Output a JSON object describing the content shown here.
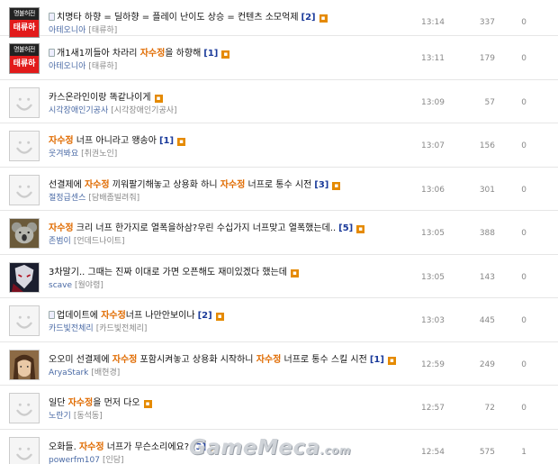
{
  "posts": [
    {
      "avatar": "badge",
      "badge_top": "명불허전",
      "badge_bottom": "태류하",
      "doc": true,
      "segments": [
        {
          "t": "치명타 하향 = 딜하향 = 플레이 난이도 상승 = 컨텐츠 소모억제"
        }
      ],
      "comments": "[2]",
      "new_icon": "new-icon",
      "author": "아테오니아",
      "group": "[태류하]",
      "time": "13:14",
      "views": "337",
      "likes": "0"
    },
    {
      "avatar": "badge",
      "badge_top": "명불허전",
      "badge_bottom": "태류하",
      "doc": true,
      "segments": [
        {
          "t": "개1새1끼들아 차라리 "
        },
        {
          "t": "자수정",
          "hl": true
        },
        {
          "t": "을 하향해"
        }
      ],
      "comments": "[1]",
      "new_icon": "new-icon",
      "author": "아테오니아",
      "group": "[태류하]",
      "time": "13:11",
      "views": "179",
      "likes": "0"
    },
    {
      "avatar": "default",
      "doc": false,
      "segments": [
        {
          "t": "카스온라인이랑 똑같나이게"
        }
      ],
      "comments": "",
      "new_icon": "new-icon",
      "author": "시각장애인기공사",
      "group": "[시각장애인기공사]",
      "time": "13:09",
      "views": "57",
      "likes": "0"
    },
    {
      "avatar": "default",
      "doc": false,
      "segments": [
        {
          "t": "자수정",
          "hl": true
        },
        {
          "t": " 너프 아니라고 왱송아"
        }
      ],
      "comments": "[1]",
      "new_icon": "new-icon",
      "author": "웃겨봐요",
      "group": "[취권노인]",
      "time": "13:07",
      "views": "156",
      "likes": "0"
    },
    {
      "avatar": "default",
      "doc": false,
      "segments": [
        {
          "t": "선결제에 "
        },
        {
          "t": "자수정",
          "hl": true
        },
        {
          "t": " 끼워팔기해놓고 상용화 하니 "
        },
        {
          "t": "자수정",
          "hl": true
        },
        {
          "t": " 너프로 통수 시전"
        }
      ],
      "comments": "[3]",
      "new_icon": "new-icon",
      "author": "절정급센스",
      "group": "[담배좀빌려줘]",
      "time": "13:06",
      "views": "301",
      "likes": "0"
    },
    {
      "avatar": "koala",
      "doc": false,
      "segments": [
        {
          "t": "자수정",
          "hl": true
        },
        {
          "t": " 크리 너프 한가지로 열폭을하삼?우린 수십가지 너프맞고 열폭했는데.."
        }
      ],
      "comments": "[5]",
      "new_icon": "new-icon",
      "author": "존범이",
      "group": "[언데드나이트]",
      "time": "13:05",
      "views": "388",
      "likes": "0"
    },
    {
      "avatar": "dark",
      "doc": false,
      "segments": [
        {
          "t": "3차말기.. 그때는 진짜 이대로 가면 오픈해도 재미있겠다 했는데"
        }
      ],
      "comments": "",
      "new_icon": "new-icon",
      "author": "scave",
      "group": "[월야령]",
      "time": "13:05",
      "views": "143",
      "likes": "0"
    },
    {
      "avatar": "default",
      "doc": true,
      "segments": [
        {
          "t": "업데이트에 "
        },
        {
          "t": "자수정",
          "hl": true
        },
        {
          "t": "너프 나만안보이나"
        }
      ],
      "comments": "[2]",
      "new_icon": "new-icon",
      "author": "카드빛전체리",
      "group": "[카드빛전체리]",
      "time": "13:03",
      "views": "445",
      "likes": "0"
    },
    {
      "avatar": "girl",
      "doc": false,
      "segments": [
        {
          "t": "오오미 선결제에 "
        },
        {
          "t": "자수정",
          "hl": true
        },
        {
          "t": " 포함시켜놓고 상용화 시작하니 "
        },
        {
          "t": "자수정",
          "hl": true
        },
        {
          "t": " 너프로 통수 스킬 시전"
        }
      ],
      "comments": "[1]",
      "new_icon": "new-icon",
      "author": "AryaStark",
      "group": "[배현경]",
      "time": "12:59",
      "views": "249",
      "likes": "0"
    },
    {
      "avatar": "default",
      "doc": false,
      "segments": [
        {
          "t": "일단 "
        },
        {
          "t": "자수정",
          "hl": true
        },
        {
          "t": "을 먼저 다오"
        }
      ],
      "comments": "",
      "new_icon": "new-icon",
      "author": "노란기",
      "group": "[동석동]",
      "time": "12:57",
      "views": "72",
      "likes": "0"
    },
    {
      "avatar": "default",
      "doc": false,
      "segments": [
        {
          "t": "오화들. "
        },
        {
          "t": "자수정",
          "hl": true
        },
        {
          "t": " 너프가 무슨소리에요?"
        }
      ],
      "comments": "[3]",
      "new_icon": "new-icon",
      "author": "powerfm107",
      "group": "[인담]",
      "time": "12:54",
      "views": "575",
      "likes": "1"
    }
  ],
  "watermark": {
    "text": "GameMeca",
    "suffix": ".com"
  }
}
